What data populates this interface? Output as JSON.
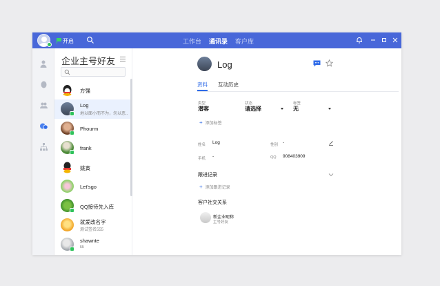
{
  "titlebar": {
    "open_label": "开启",
    "nav": [
      {
        "label": "工作台",
        "active": false
      },
      {
        "label": "通讯录",
        "active": true
      },
      {
        "label": "客户库",
        "active": false
      }
    ]
  },
  "contact_list": {
    "title": "企业主号好友",
    "search_placeholder": "",
    "items": [
      {
        "name": "方强",
        "sub": ""
      },
      {
        "name": "Log",
        "sub": "地以面小而不为，勿以恶..."
      },
      {
        "name": "Phourm",
        "sub": ""
      },
      {
        "name": "frank",
        "sub": ""
      },
      {
        "name": "姚寅",
        "sub": ""
      },
      {
        "name": "Let'sgo",
        "sub": ""
      },
      {
        "name": "QQ接待先入库",
        "sub": ""
      },
      {
        "name": "就爱改名字",
        "sub": "测试签名555"
      },
      {
        "name": "shawnte",
        "sub": "kk"
      }
    ]
  },
  "detail": {
    "name": "Log",
    "tabs": [
      {
        "label": "资料",
        "active": true
      },
      {
        "label": "互动历史",
        "active": false
      }
    ],
    "type_label": "类型",
    "type_value": "潜客",
    "status_label": "状态",
    "status_value": "请选择",
    "follow_label": "标签",
    "follow_value": "无",
    "add_tag": "添加标签",
    "name_label": "姓名",
    "name_value": "Log",
    "gender_label": "性别",
    "gender_value": "-",
    "phone_label": "手机",
    "phone_value": "-",
    "qq_label": "QQ",
    "qq_value": "908403909",
    "followup_title": "跟进记录",
    "add_followup": "添加跟进记录",
    "social_title": "客户社交关系",
    "social_name": "新企业昵称",
    "social_sub": "主号好友"
  },
  "colors": {
    "titlebar": "#4867d9",
    "accent": "#2f6be8",
    "online": "#2fc25b"
  }
}
